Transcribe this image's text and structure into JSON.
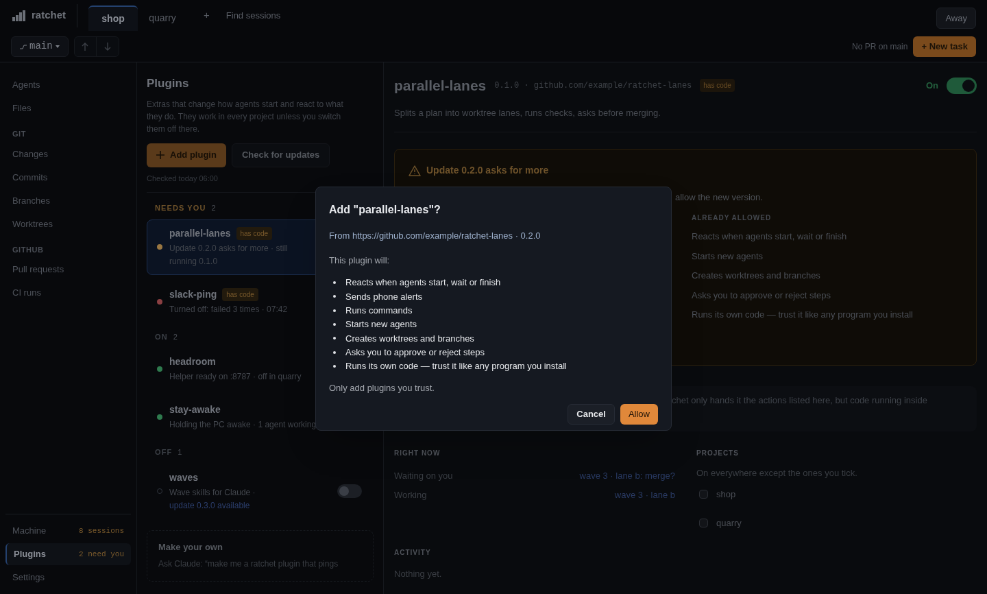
{
  "app": {
    "name": "ratchet"
  },
  "tabs": [
    {
      "label": "shop",
      "selected": true
    },
    {
      "label": "quarry",
      "selected": false
    }
  ],
  "new_tab": "+",
  "find_sessions": "Find sessions",
  "status_button": "Away",
  "branch": "main",
  "pr_status": "No PR on main",
  "new_task": "+ New task",
  "sidebar": {
    "sections": [
      {
        "items": [
          {
            "label": "Agents"
          },
          {
            "label": "Files"
          }
        ]
      },
      {
        "heading": "GIT",
        "items": [
          {
            "label": "Changes"
          },
          {
            "label": "Commits"
          },
          {
            "label": "Branches"
          },
          {
            "label": "Worktrees"
          }
        ]
      },
      {
        "heading": "GITHUB",
        "items": [
          {
            "label": "Pull requests"
          },
          {
            "label": "CI runs"
          }
        ]
      }
    ],
    "footer": [
      {
        "label": "Machine",
        "badge": "8 sessions",
        "selected": false
      },
      {
        "label": "Plugins",
        "badge": "2 need you",
        "selected": true
      },
      {
        "label": "Settings",
        "selected": false
      }
    ]
  },
  "plugins": {
    "title": "Plugins",
    "description": "Extras that change how agents start and react to what they do. They work in every project unless you switch them off there.",
    "add_button": "Add plugin",
    "check_button": "Check for updates",
    "checked": "Checked today 06:00",
    "groups": [
      {
        "heading": "NEEDS YOU",
        "count": "2",
        "kind": "attention",
        "items": [
          {
            "name": "parallel-lanes",
            "badge": "has code",
            "status": "Update 0.2.0 asks for more · still running 0.1.0",
            "color": "#9a7742",
            "selected": true
          },
          {
            "name": "slack-ping",
            "badge": "has code",
            "status": "Turned off: failed 3 times · 07:42",
            "color": "#8a3f42",
            "selected": false
          }
        ]
      },
      {
        "heading": "ON",
        "count": "2",
        "kind": "plain",
        "items": [
          {
            "name": "headroom",
            "status": "Helper ready on :8787 · off in quarry",
            "color": "#2f7a4e",
            "selected": false
          },
          {
            "name": "stay-awake",
            "status": "Holding the PC awake · 1 agent working",
            "color": "#2f7a4e",
            "selected": false
          }
        ]
      },
      {
        "heading": "OFF",
        "count": "1",
        "kind": "plain",
        "items": [
          {
            "name": "waves",
            "status": "Wave skills for Claude · ",
            "link": "update 0.3.0 available",
            "color": "#2e333b",
            "selected": false,
            "switch": {
              "on": false
            }
          }
        ]
      }
    ],
    "make_your_own": {
      "title": "Make your own",
      "text": "Ask Claude: “make me a ratchet plugin that pings"
    }
  },
  "detail": {
    "name": "parallel-lanes",
    "meta": "0.1.0 · github.com/example/ratchet-lanes",
    "badge": "has code",
    "toggle_label": "On",
    "on": true,
    "description": "Splits a plan into worktree lanes, runs checks, asks before merging.",
    "warning": {
      "title": "Update 0.2.0 asks for more",
      "fragment": "allow the new version.",
      "allowed_heading": "ALREADY ALLOWED",
      "allowed": [
        "Reacts when agents start, wait or finish",
        "Starts new agents",
        "Creates worktrees and branches",
        "Asks you to approve or reject steps",
        "Runs its own code — trust it like any program you install"
      ]
    },
    "note_fragment": "chet only hands it the actions listed here, but code running inside",
    "right_now": {
      "heading": "RIGHT NOW",
      "rows": [
        {
          "label": "Waiting on you",
          "value": "wave 3 · lane b: merge?"
        },
        {
          "label": "Working",
          "value": "wave 3 · lane b"
        }
      ]
    },
    "projects": {
      "heading": "PROJECTS",
      "hint": "On everywhere except the ones you tick.",
      "items": [
        {
          "label": "shop",
          "checked": false
        },
        {
          "label": "quarry",
          "checked": false
        }
      ]
    },
    "activity": {
      "heading": "ACTIVITY",
      "empty": "Nothing yet."
    }
  },
  "dialog": {
    "title": "Add \"parallel-lanes\"?",
    "source": "From https://github.com/example/ratchet-lanes · 0.2.0",
    "intro": "This plugin will:",
    "permissions": [
      "Reacts when agents start, wait or finish",
      "Sends phone alerts",
      "Runs commands",
      "Starts new agents",
      "Creates worktrees and branches",
      "Asks you to approve or reject steps",
      "Runs its own code — trust it like any program you install"
    ],
    "footnote": "Only add plugins you trust.",
    "cancel": "Cancel",
    "allow": "Allow"
  }
}
